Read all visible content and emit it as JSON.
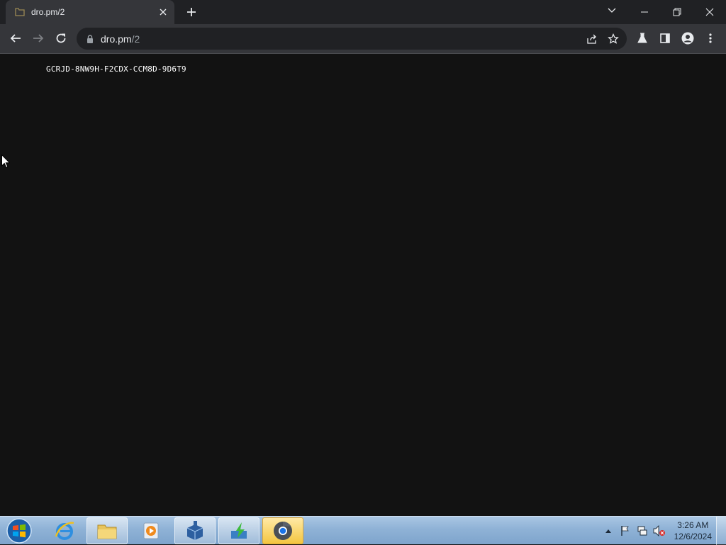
{
  "browser": {
    "tab": {
      "title": "dro.pm/2"
    },
    "omnibox": {
      "url_host": "dro.pm",
      "url_path": "/2"
    }
  },
  "page": {
    "key_text": "GCRJD-8NW9H-F2CDX-CCM8D-9D6T9"
  },
  "taskbar": {
    "clock": {
      "time": "3:26 AM",
      "date": "12/6/2024"
    }
  }
}
